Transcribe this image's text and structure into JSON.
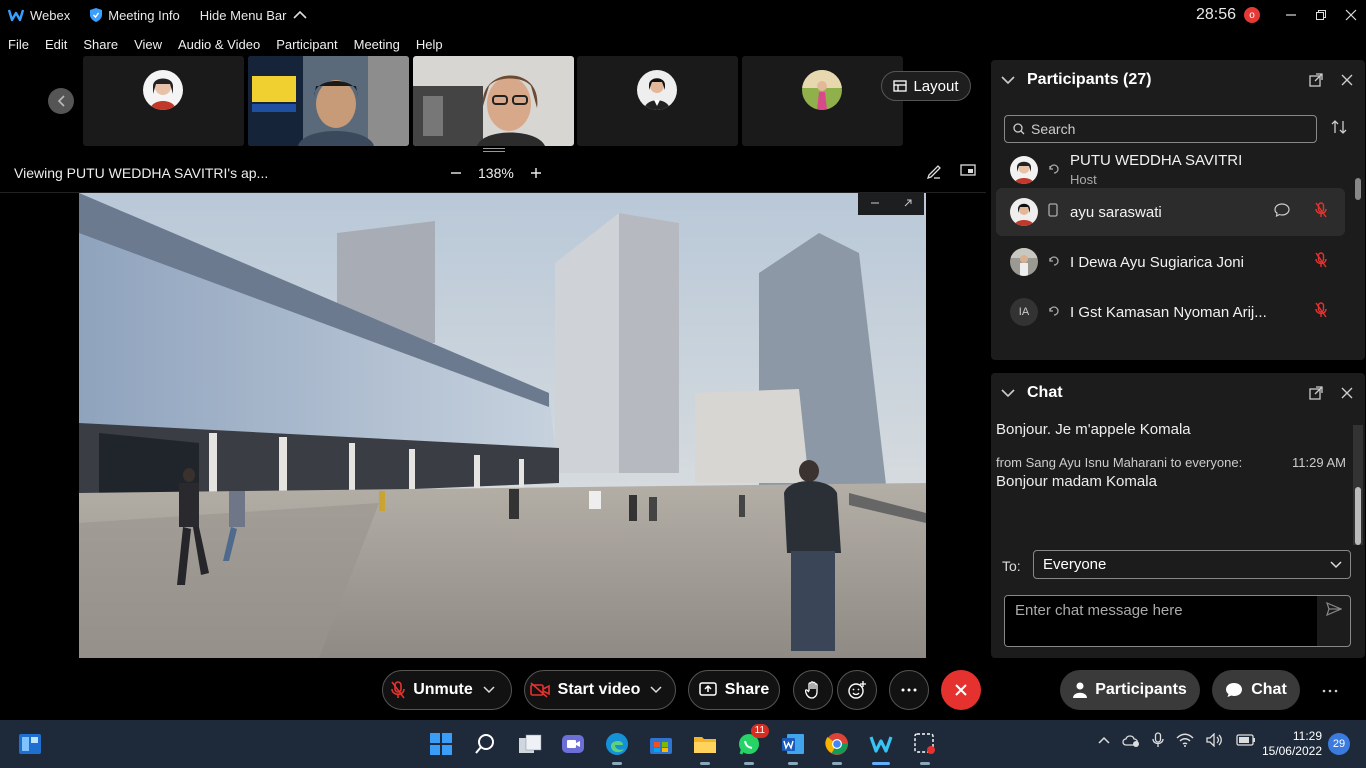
{
  "titlebar": {
    "app_name": "Webex",
    "meeting_info": "Meeting Info",
    "hide_menu_bar": "Hide Menu Bar",
    "timer": "28:56",
    "rec_indicator": "o"
  },
  "menu": [
    "File",
    "Edit",
    "Share",
    "View",
    "Audio & Video",
    "Participant",
    "Meeting",
    "Help"
  ],
  "stage": {
    "layout_label": "Layout",
    "viewing_text": "Viewing PUTU WEDDHA SAVITRI's ap...",
    "zoom_level": "138%"
  },
  "controls": {
    "unmute": "Unmute",
    "start_video": "Start video",
    "share": "Share",
    "participants": "Participants",
    "chat": "Chat"
  },
  "participants_panel": {
    "title": "Participants (27)",
    "search_placeholder": "Search",
    "items": [
      {
        "name": "PUTU WEDDHA SAVITRI",
        "role": "Host"
      },
      {
        "name": "ayu saraswati",
        "role": ""
      },
      {
        "name": "I Dewa Ayu Sugiarica Joni",
        "role": ""
      },
      {
        "name": "I Gst Kamasan Nyoman Arij...",
        "role": "",
        "initials": "IA"
      }
    ]
  },
  "chat_panel": {
    "title": "Chat",
    "messages": [
      {
        "text": "Bonjour. Je m'appele Komala"
      },
      {
        "meta": "from Sang Ayu Isnu Maharani to everyone:",
        "time": "11:29 AM",
        "text": "Bonjour madam Komala"
      }
    ],
    "to_label": "To:",
    "to_value": "Everyone",
    "input_placeholder": "Enter chat message here"
  },
  "taskbar": {
    "whatsapp_badge": "11",
    "clock_time": "11:29",
    "clock_date": "15/06/2022",
    "notification_count": "29"
  },
  "colors": {
    "end_call": "#e5322e",
    "mute_red": "#e5322e",
    "taskbar": "#1e2a3a"
  }
}
